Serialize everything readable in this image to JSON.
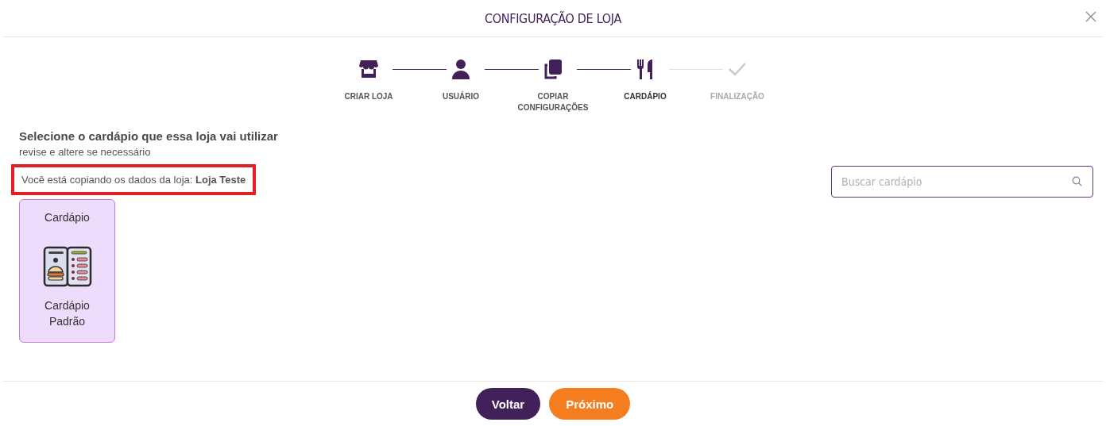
{
  "window": {
    "title": "CONFIGURAÇÃO DE LOJA"
  },
  "steps": [
    {
      "label": "CRIAR LOJA",
      "selected": false
    },
    {
      "label": "USUÁRIO",
      "selected": false
    },
    {
      "label": "COPIAR CONFIGURAÇÕES",
      "selected": false
    },
    {
      "label": "CARDÁPIO",
      "selected": true
    },
    {
      "label": "FINALIZAÇÃO",
      "selected": false
    }
  ],
  "heading": "Selecione o cardápio que essa loja vai utilizar",
  "subheading": "revise e altere se necessário",
  "notice": {
    "text": "Você está copiando os dados da loja: **Loja Teste**",
    "highlighted": true
  },
  "search": {
    "placeholder": "Buscar cardápio"
  },
  "cards": [
    {
      "title": "Cardápio",
      "name": "Cardápio Padrão",
      "selected": true
    }
  ],
  "buttons": [
    {
      "label": "Voltar",
      "kind": "secondary"
    },
    {
      "label": "Próximo",
      "kind": "primary"
    }
  ]
}
